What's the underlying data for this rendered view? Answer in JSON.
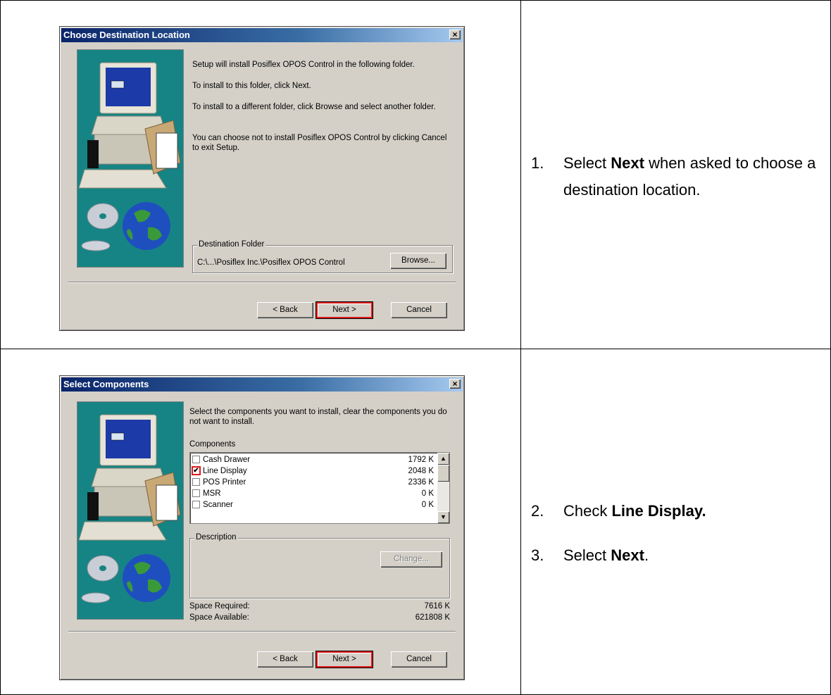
{
  "dialog1": {
    "title": "Choose Destination Location",
    "close_glyph": "×",
    "paragraphs": [
      "Setup will install Posiflex OPOS Control in the following folder.",
      "To install to this folder, click Next.",
      "To install to a different folder, click Browse and select another folder.",
      "You can choose not to install Posiflex OPOS Control by clicking Cancel to exit Setup."
    ],
    "group_label": "Destination Folder",
    "folder_path": "C:\\...\\Posiflex Inc.\\Posiflex OPOS Control",
    "browse_label": "Browse...",
    "back_label": "< Back",
    "next_label": "Next >",
    "cancel_label": "Cancel"
  },
  "step1": {
    "number": "1.",
    "text_before": "Select ",
    "bold": "Next",
    "text_after": " when asked to choose a destination location."
  },
  "dialog2": {
    "title": "Select Components",
    "close_glyph": "×",
    "intro": "Select the components you want to install, clear the components you do not want to install.",
    "components_label": "Components",
    "components": [
      {
        "name": "Cash Drawer",
        "size": "1792 K",
        "checked": false
      },
      {
        "name": "Line Display",
        "size": "2048 K",
        "checked": true
      },
      {
        "name": "POS Printer",
        "size": "2336 K",
        "checked": false
      },
      {
        "name": "MSR",
        "size": "0 K",
        "checked": false
      },
      {
        "name": "Scanner",
        "size": "0 K",
        "checked": false
      }
    ],
    "description_label": "Description",
    "change_label": "Change...",
    "space_required_label": "Space Required:",
    "space_required_value": "7616 K",
    "space_available_label": "Space Available:",
    "space_available_value": "621808 K",
    "back_label": "< Back",
    "next_label": "Next >",
    "cancel_label": "Cancel"
  },
  "step2": {
    "number": "2.",
    "text_before": "Check ",
    "bold": "Line Display."
  },
  "step3": {
    "number": "3.",
    "text_before": "Select ",
    "bold": "Next",
    "text_after": "."
  },
  "colors": {
    "highlight": "#e01b1b",
    "art_bg": "#168484",
    "dialog_bg": "#d4d0c8",
    "titlebar": "#0a246a"
  }
}
